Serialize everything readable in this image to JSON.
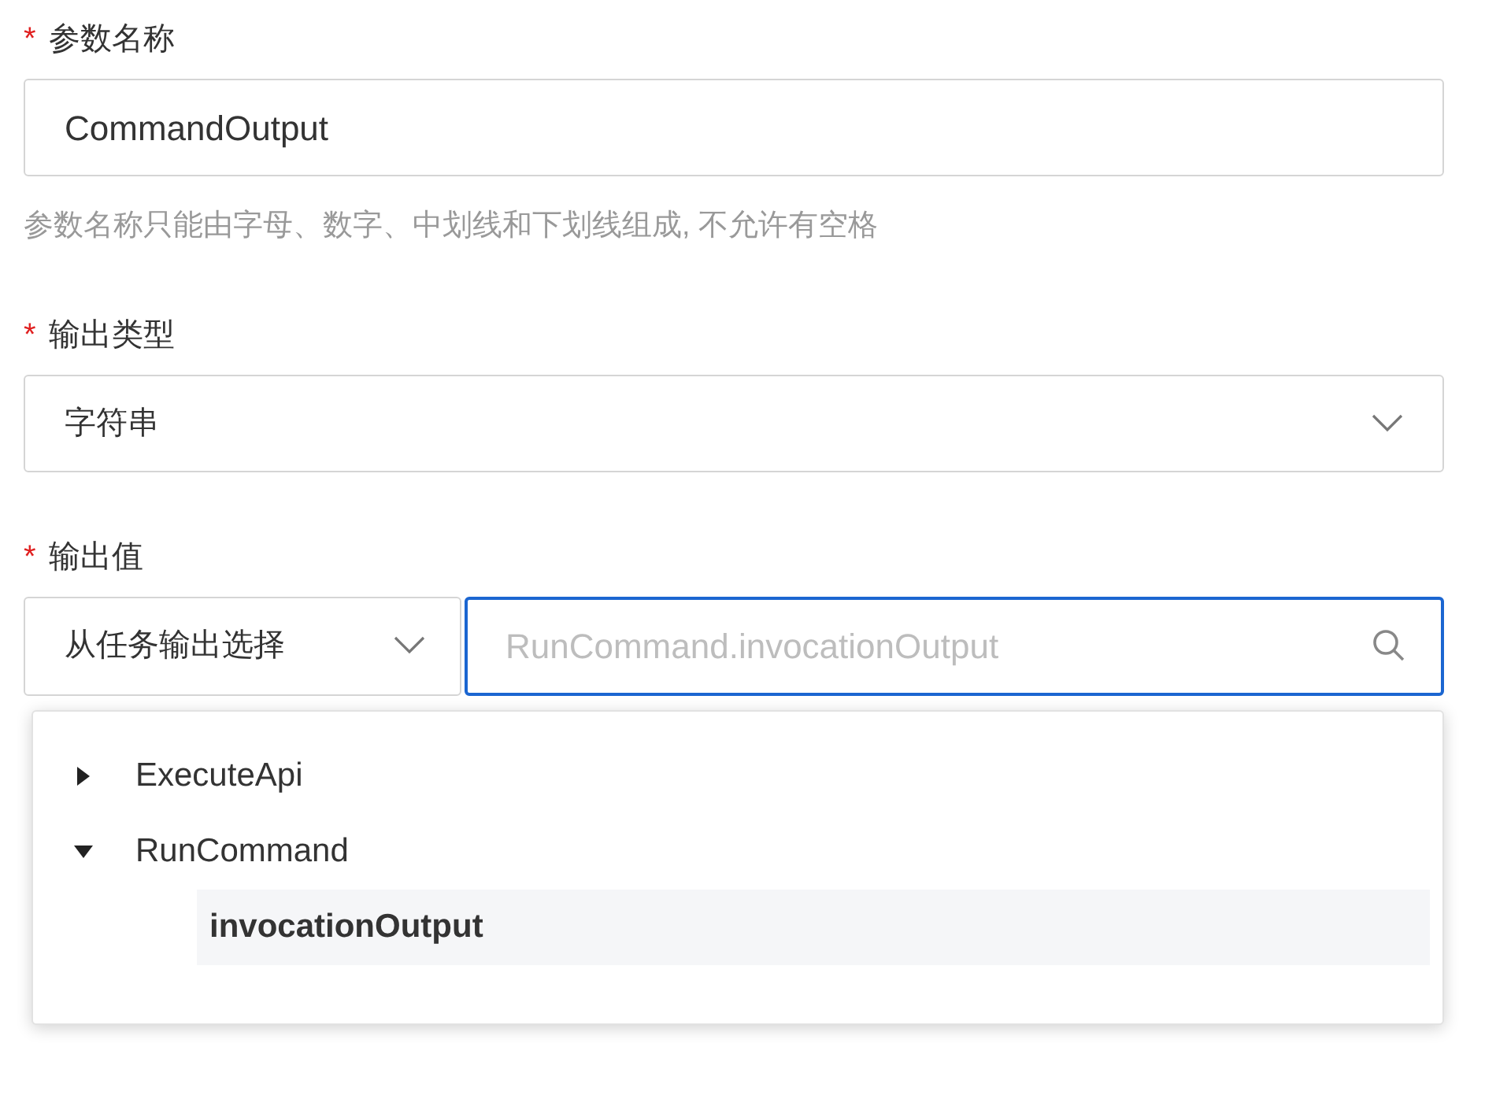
{
  "fields": [
    {
      "label": "参数名称",
      "required_mark": "*",
      "kind": "input",
      "value": "CommandOutput",
      "hint": "参数名称只能由字母、数字、中划线和下划线组成, 不允许有空格"
    },
    {
      "label": "输出类型",
      "required_mark": "*",
      "kind": "select",
      "value": "字符串"
    },
    {
      "label": "输出值",
      "required_mark": "*",
      "kind": "combo",
      "source": "从任务输出选择",
      "placeholder": "RunCommand.invocationOutput"
    }
  ],
  "dropdown": {
    "items": [
      {
        "label": "ExecuteApi",
        "expanded": false,
        "selected": false
      },
      {
        "label": "RunCommand",
        "expanded": true,
        "selected": false,
        "children": [
          {
            "label": "invocationOutput",
            "selected": true
          }
        ]
      }
    ]
  }
}
